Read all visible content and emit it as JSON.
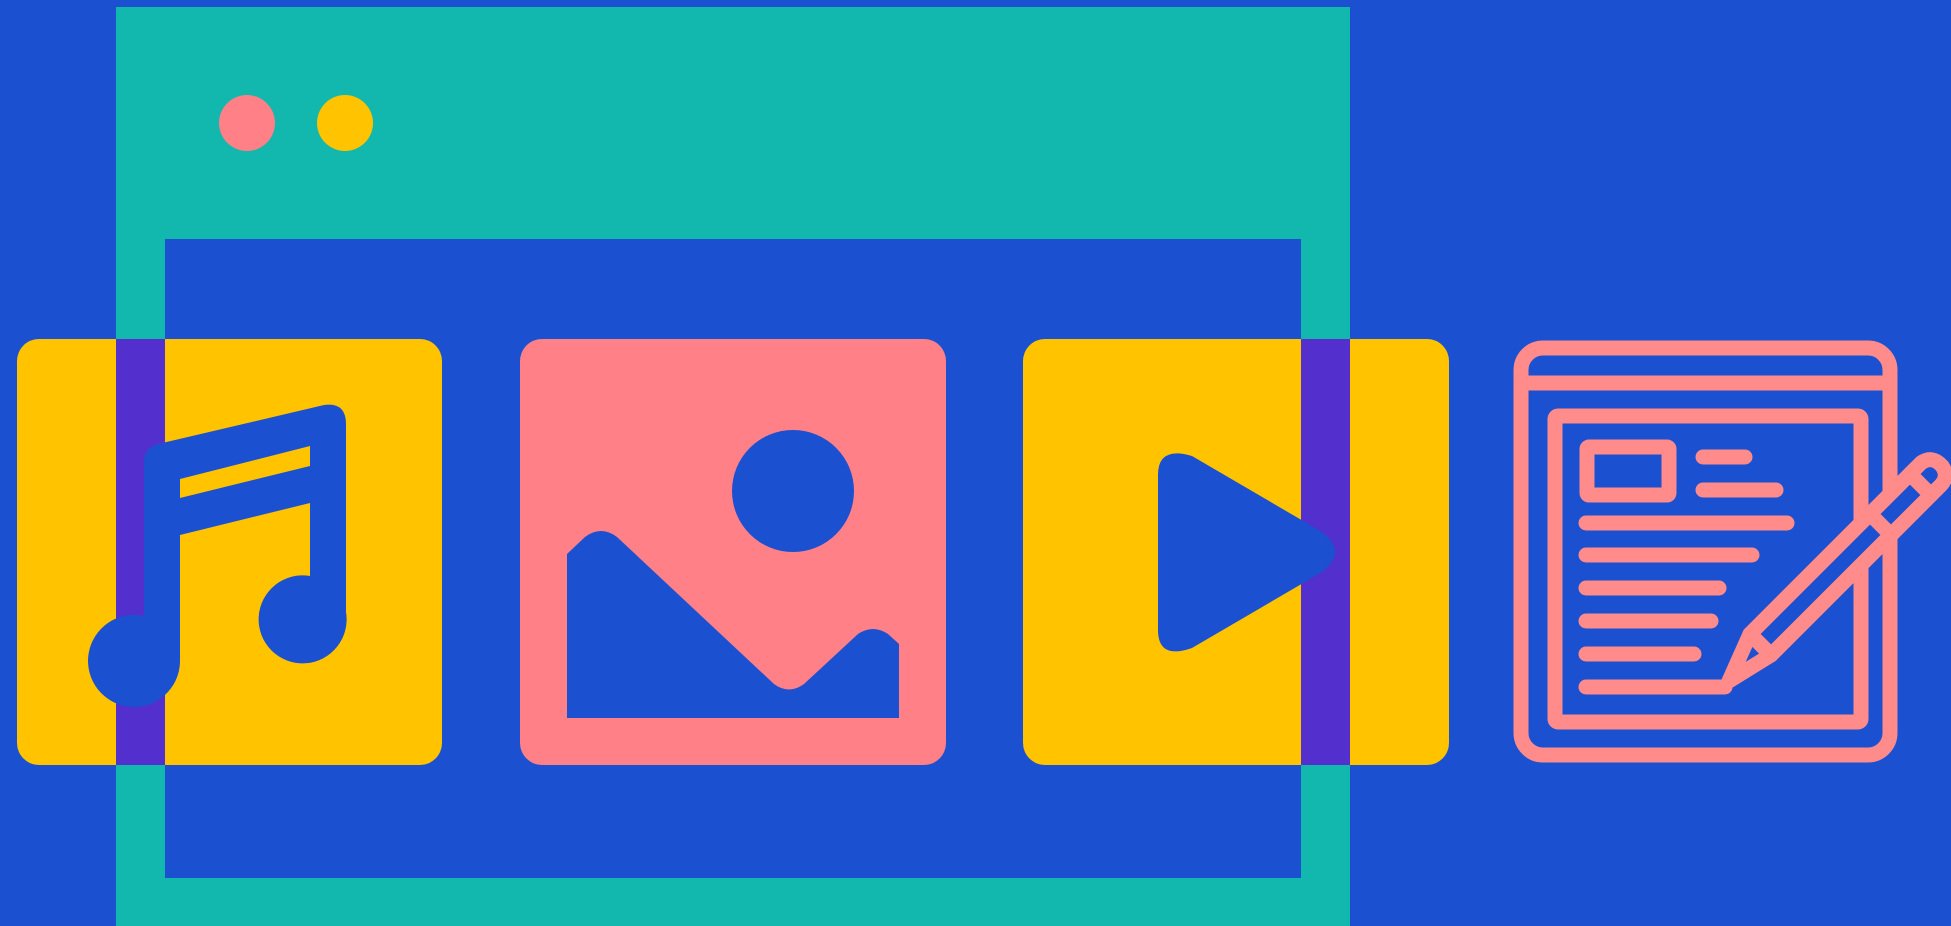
{
  "colors": {
    "background": "#1b50d0",
    "teal": "#12b8ad",
    "yellow": "#ffc300",
    "coral": "#ff8086",
    "purple": "#5330cd"
  },
  "browser_window": {
    "tabs": [
      "active-tab",
      "inactive-tab"
    ],
    "window_controls": [
      "close-dot",
      "minimize-dot",
      "maximize-dot"
    ]
  },
  "media_tiles": [
    {
      "icon": "music-note-icon"
    },
    {
      "icon": "image-icon"
    },
    {
      "icon": "play-icon"
    }
  ],
  "side_icon": "document-edit-icon"
}
